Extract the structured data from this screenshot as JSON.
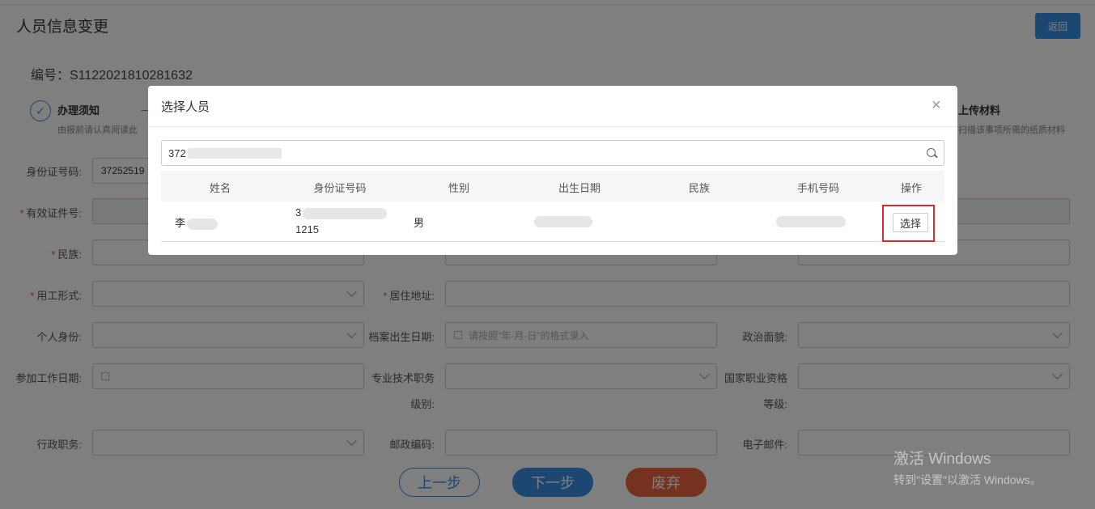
{
  "page": {
    "title": "人员信息变更",
    "back_label": "返回",
    "serial": "编号：S1122021810281632"
  },
  "steps": [
    {
      "title": "办理须知",
      "desc": "由报前请认真阅读此"
    },
    {
      "title": "上传材料",
      "desc": "扫描该事项所需的纸质材料"
    }
  ],
  "form": {
    "id_number": {
      "label": "身份证号码:",
      "value": "37252519"
    },
    "valid_cert": {
      "label": "有效证件号:"
    },
    "ethnicity": {
      "label": "民族:"
    },
    "employment": {
      "label": "用工形式:"
    },
    "address": {
      "label": "居住地址:"
    },
    "identity": {
      "label": "个人身份:"
    },
    "archive_birth": {
      "label": "档案出生日期:",
      "placeholder": "请按照\"年-月-日\"的格式录入"
    },
    "political": {
      "label": "政治面貌:"
    },
    "work_date": {
      "label": "参加工作日期:"
    },
    "tech_title": {
      "label1": "专业技术职务",
      "label2": "级别:"
    },
    "vocational": {
      "label1": "国家职业资格",
      "label2": "等级:"
    },
    "admin_title": {
      "label": "行政职务:"
    },
    "postcode": {
      "label": "邮政编码:"
    },
    "email": {
      "label": "电子邮件:"
    }
  },
  "buttons": {
    "prev": "上一步",
    "next": "下一步",
    "discard": "废弃"
  },
  "watermark": {
    "line1": "激活 Windows",
    "line2": "转到\"设置\"以激活 Windows。"
  },
  "dialog": {
    "title": "选择人员",
    "close": "×",
    "search_value": "372",
    "columns": [
      "姓名",
      "身份证号码",
      "性别",
      "出生日期",
      "民族",
      "手机号码",
      "操作"
    ],
    "rows": [
      {
        "name": "李",
        "id_line1": "3",
        "id_line2": "1215",
        "gender": "男",
        "birth": "",
        "ethnicity": "",
        "phone": "",
        "action": "选择"
      }
    ]
  }
}
